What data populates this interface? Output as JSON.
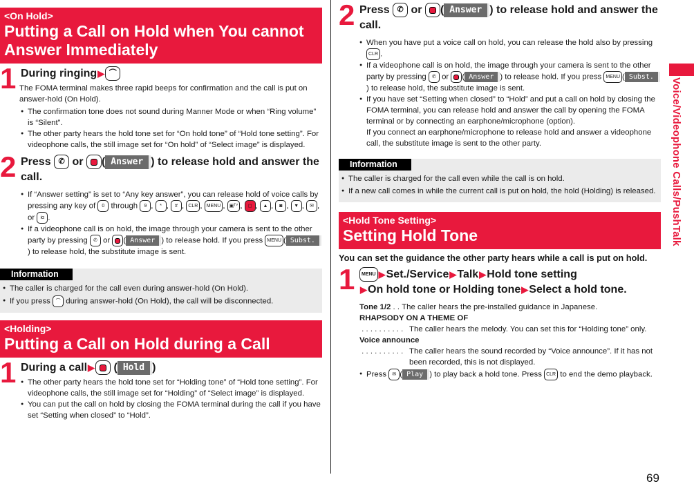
{
  "side_tab": {
    "label": "Voice/Videophone Calls/PushTalk",
    "color": "#e8193d"
  },
  "page_number": "69",
  "left": {
    "onhold": {
      "tag": "<On Hold>",
      "title": "Putting a Call on Hold when You cannot Answer Immediately",
      "step1": {
        "num": "1",
        "head_text": "During ringing",
        "body": "The FOMA terminal makes three rapid beeps for confirmation and the call is put on answer-hold (On Hold).",
        "bullets": [
          "The confirmation tone does not sound during Manner Mode or when “Ring volume” is “Silent”.",
          "The other party hears the hold tone set for “On hold tone” of “Hold tone setting”. For videophone calls, the still image set for “On hold” of “Select image” is displayed."
        ]
      },
      "step2": {
        "num": "2",
        "head_press": "Press",
        "head_or": "or",
        "head_rest": ") to release hold and answer the call.",
        "softkey": "Answer",
        "bullet1_a": "If “Answer setting” is set to “Any key answer”, you can release hold of voice calls by pressing any key of",
        "bullet1_through": "through",
        "bullet1_or": ", or",
        "bullet2_a": "If a videophone call is on hold, the image through your camera is sent to the other party by pressing",
        "bullet2_or": "or",
        "bullet2_b": ") to release hold. If you press",
        "bullet2_c": ") to release hold, the substitute image is sent.",
        "softkey_subst": "Subst."
      }
    },
    "info": {
      "label": "Information",
      "bullets": [
        "The caller is charged for the call even during answer-hold (On Hold)."
      ],
      "bullet2_a": "If you press",
      "bullet2_b": "during answer-hold (On Hold), the call will be disconnected."
    },
    "holding": {
      "tag": "<Holding>",
      "title": "Putting a Call on Hold during a Call",
      "step1": {
        "num": "1",
        "head_text": "During a call",
        "softkey": "Hold",
        "bullets": [
          "The other party hears the hold tone set for “Holding tone” of “Hold tone setting”. For videophone calls, the still image set for “Holding” of “Select image” is displayed.",
          "You can put the call on hold by closing the FOMA terminal during the call if you have set “Setting when closed” to “Hold”."
        ]
      }
    }
  },
  "right": {
    "step2": {
      "num": "2",
      "head_press": "Press",
      "head_or": "or",
      "head_rest": ") to release hold and answer the call.",
      "softkey": "Answer",
      "bullet1_a": "When you have put a voice call on hold, you can release the hold also by pressing",
      "bullet2_a": "If a videophone call is on hold, the image through your camera is sent to the other party by pressing",
      "bullet2_or": "or",
      "bullet2_b": ") to release hold. If you press",
      "bullet2_c": ") to release hold, the substitute image is sent.",
      "softkey_subst": "Subst.",
      "bullet3": "If you have set “Setting when closed” to “Hold” and put a call on hold by closing the FOMA terminal, you can release hold and answer the call by opening the FOMA terminal or by connecting an earphone/microphone (option).",
      "bullet3_cont": "If you connect an earphone/microphone to release hold and answer a videophone call, the substitute image is sent to the other party."
    },
    "info": {
      "label": "Information",
      "bullets": [
        "The caller is charged for the call even while the call is on hold.",
        "If a new call comes in while the current call is put on hold, the hold (Holding) is released."
      ]
    },
    "holdtone": {
      "tag": "<Hold Tone Setting>",
      "title": "Setting Hold Tone",
      "intro": "You can set the guidance the other party hears while a call is put on hold.",
      "step1": {
        "num": "1",
        "path": [
          "Set./Service",
          "Talk",
          "Hold tone setting",
          "On hold tone or Holding tone",
          "Select a hold tone."
        ],
        "options": [
          {
            "term": "Tone 1/2",
            "dots": " . . ",
            "desc": "The caller hears the pre-installed guidance in Japanese."
          },
          {
            "term": "RHAPSODY ON A THEME OF",
            "dots": " . . . . . . . . . . ",
            "desc": "The caller hears the melody. You can set this for “Holding tone” only."
          },
          {
            "term": "Voice announce",
            "dots": " . . . . . . . . . . ",
            "desc": "The caller hears the sound recorded by “Voice announce”. If it has not been recorded, this is not displayed."
          }
        ],
        "bullet_a": "Press",
        "softkey_play": "Play",
        "bullet_b": ") to play back a hold tone. Press",
        "bullet_c": "to end the demo playback."
      }
    }
  },
  "keys": {
    "end": "end-call-key",
    "start": "start-call-key",
    "center": "center-key",
    "menu": "MENU",
    "clr": "CLR",
    "zero": "0",
    "nine": "9",
    "star": "*",
    "hash": "#",
    "camera": "camera-tv-key",
    "up": "▲",
    "down": "▼",
    "mail": "mail-key",
    "ialpha": "iα"
  }
}
